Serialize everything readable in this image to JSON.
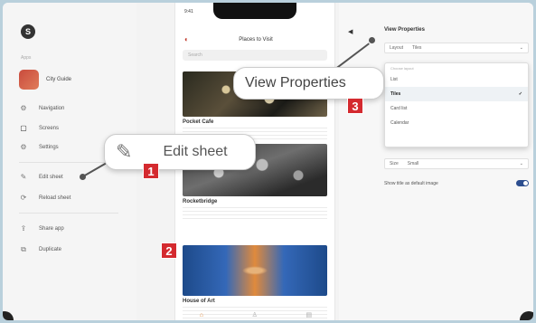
{
  "sidebar": {
    "logo_letter": "S",
    "section_label": "Apps",
    "app_name": "City Guide",
    "items": [
      {
        "label": "Navigation",
        "icon": "⚙"
      },
      {
        "label": "Screens",
        "icon": "▢"
      },
      {
        "label": "Settings",
        "icon": "⚙"
      },
      {
        "label": "Edit sheet",
        "icon": "✎"
      },
      {
        "label": "Reload sheet",
        "icon": "⟳"
      },
      {
        "label": "Share app",
        "icon": "⇪"
      },
      {
        "label": "Duplicate",
        "icon": "⧉"
      }
    ]
  },
  "phone": {
    "time": "9:41",
    "title": "Places to Visit",
    "search_placeholder": "Search",
    "cards": [
      {
        "title": "Pocket Cafe"
      },
      {
        "title": "Rocketbridge"
      },
      {
        "title": "House of Art"
      }
    ]
  },
  "panel": {
    "title": "View Properties",
    "layout_label": "Layout",
    "layout_value": "Tiles",
    "dropdown_header": "Choose layout",
    "options": [
      {
        "label": "List",
        "selected": false
      },
      {
        "label": "Tiles",
        "selected": true
      },
      {
        "label": "Card list",
        "selected": false
      },
      {
        "label": "Calendar",
        "selected": false
      }
    ],
    "size_label": "Size",
    "size_value": "Small",
    "toggle_label": "Show title as default image",
    "toggle_on": true
  },
  "callouts": {
    "edit_sheet": "Edit sheet",
    "view_properties": "View Properties",
    "badge1": "1",
    "badge2": "2",
    "badge3": "3"
  },
  "colors": {
    "badge": "#d42a2f",
    "toggle": "#2c4e8f"
  }
}
